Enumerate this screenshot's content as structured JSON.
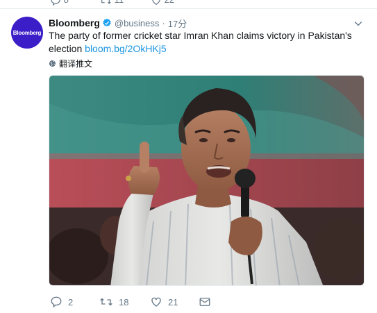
{
  "previous_tweet": {
    "reply_count": "8",
    "retweet_count": "11",
    "like_count": "22"
  },
  "tweet": {
    "author": {
      "display_name": "Bloomberg",
      "handle": "@business",
      "avatar_text": "Bloomberg",
      "avatar_color": "#3b1ec8",
      "verified": true
    },
    "timestamp": "17分",
    "separator": "·",
    "text": "The party of former cricket star Imran Khan claims victory in Pakistan's election",
    "link": "bloom.bg/2OkHKj5",
    "translate_label": "翻译推文",
    "reply_count": "2",
    "retweet_count": "18",
    "like_count": "21"
  },
  "icons": [
    "globe-icon",
    "verified-badge-icon",
    "chevron-down-icon",
    "reply-icon",
    "retweet-icon",
    "like-icon",
    "direct-message-icon"
  ],
  "colors": {
    "link": "#1b95e0",
    "muted": "#657786",
    "verified": "#1da1f2",
    "divider": "#e6ecf0"
  }
}
